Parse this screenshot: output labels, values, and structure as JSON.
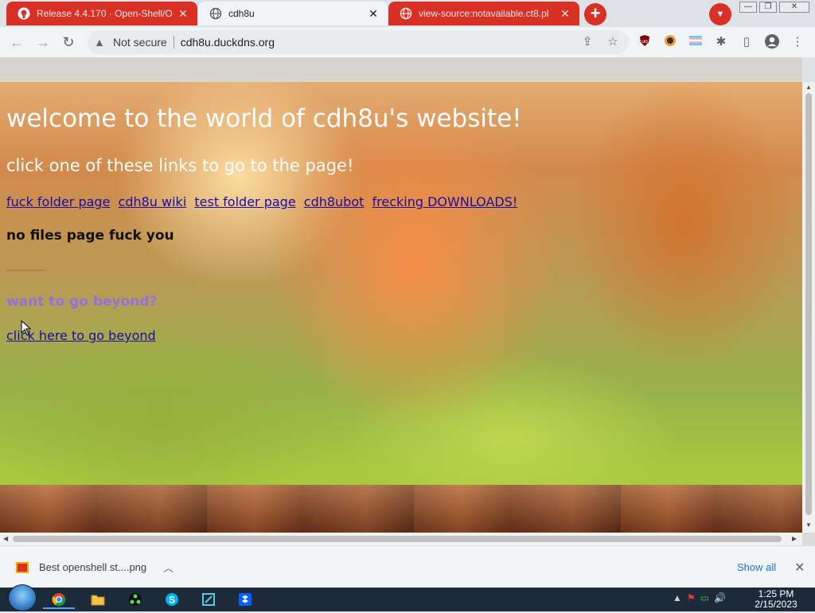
{
  "tabs": [
    {
      "title": "Release 4.4.170 · Open-Shell/O",
      "favicon": "github-icon"
    },
    {
      "title": "cdh8u",
      "favicon": "globe-icon"
    },
    {
      "title": "view-source:notavailable.ct8.pl",
      "favicon": "globe-icon"
    }
  ],
  "newtab_label": "+",
  "tab_close_glyph": "✕",
  "window_controls": {
    "minimize": "—",
    "maximize": "❐",
    "close": "✕"
  },
  "toolbar": {
    "security_text": "Not secure",
    "url": "cdh8u.duckdns.org"
  },
  "page": {
    "heading": "welcome to the world of cdh8u's website!",
    "subheading": "click one of these links to go to the page!",
    "links": [
      "fuck folder page",
      "cdh8u wiki",
      "test folder page",
      "cdh8ubot",
      "frecking DOWNLOADS!"
    ],
    "no_files_text": "no files page fuck you",
    "beyond_heading": "want to go beyond?",
    "beyond_link": "click here to go beyond"
  },
  "download_bar": {
    "filename": "Best openshell st....png",
    "show_all": "Show all"
  },
  "taskbar": {
    "time": "1:25 PM",
    "date": "2/15/2023"
  },
  "colors": {
    "tab_accent": "#d93025",
    "link": "#1a0dab",
    "visited_heading": "#9b6ee0"
  }
}
